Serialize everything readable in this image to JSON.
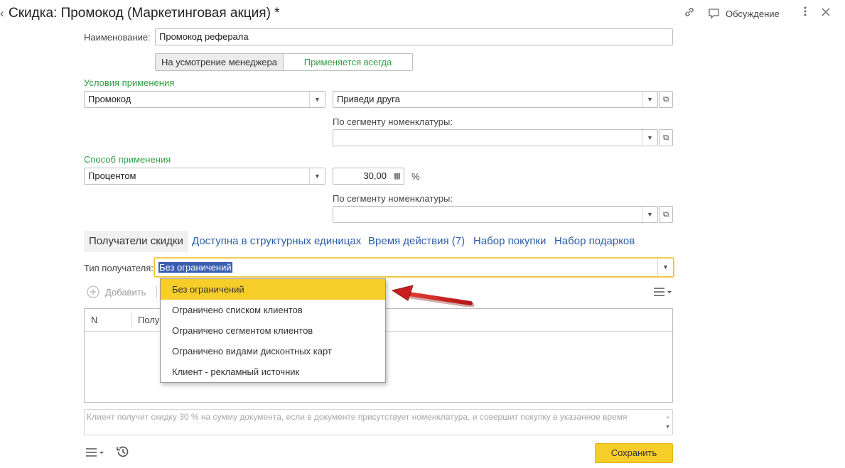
{
  "header": {
    "title": "Скидка: Промокод (Маркетинговая акция) *",
    "discussion_label": "Обсуждение"
  },
  "form": {
    "name_label": "Наименование:",
    "name_value": "Промокод реферала",
    "mode_options": [
      "На усмотрение менеджера",
      "Применяется всегда"
    ],
    "mode_selected": "Применяется всегда",
    "conditions_section": "Условия применения",
    "condition_value": "Промокод",
    "condition_object_value": "Приведи друга",
    "segment_label_1": "По сегменту номенклатуры:",
    "segment_value_1": "",
    "method_section": "Способ применения",
    "method_value": "Процентом",
    "percent_value": "30,00",
    "percent_unit": "%",
    "segment_label_2": "По сегменту номенклатуры:",
    "segment_value_2": ""
  },
  "tabs": [
    {
      "label": "Получатели скидки",
      "active": true
    },
    {
      "label": "Доступна в структурных единицах",
      "active": false
    },
    {
      "label": "Время действия (7)",
      "active": false
    },
    {
      "label": "Набор покупки",
      "active": false
    },
    {
      "label": "Набор подарков",
      "active": false
    }
  ],
  "recipients": {
    "type_label": "Тип получателя:",
    "type_value": "Без ограничений",
    "add_label": "Добавить",
    "dropdown_options": [
      "Без ограничений",
      "Ограничено списком клиентов",
      "Ограничено сегментом клиентов",
      "Ограничено видами дисконтных карт",
      "Клиент - рекламный источник"
    ],
    "dropdown_selected_index": 0,
    "table_columns": [
      "N",
      "Полу"
    ]
  },
  "hint_text": "Клиент получит скидку 30 % на сумму документа, если в документе присутствует номенклатура, и совершит покупку в указанное время",
  "footer": {
    "save_label": "Сохранить"
  },
  "colors": {
    "accent_green": "#2f9e44",
    "link_blue": "#2b5ea8",
    "highlight_yellow": "#f7cd29",
    "arrow_red": "#c8201f"
  },
  "icons": [
    "link-icon",
    "comment-icon",
    "more-vertical-icon",
    "close-icon",
    "calculator-icon",
    "open-icon",
    "menu-icon",
    "history-icon",
    "add-icon"
  ]
}
